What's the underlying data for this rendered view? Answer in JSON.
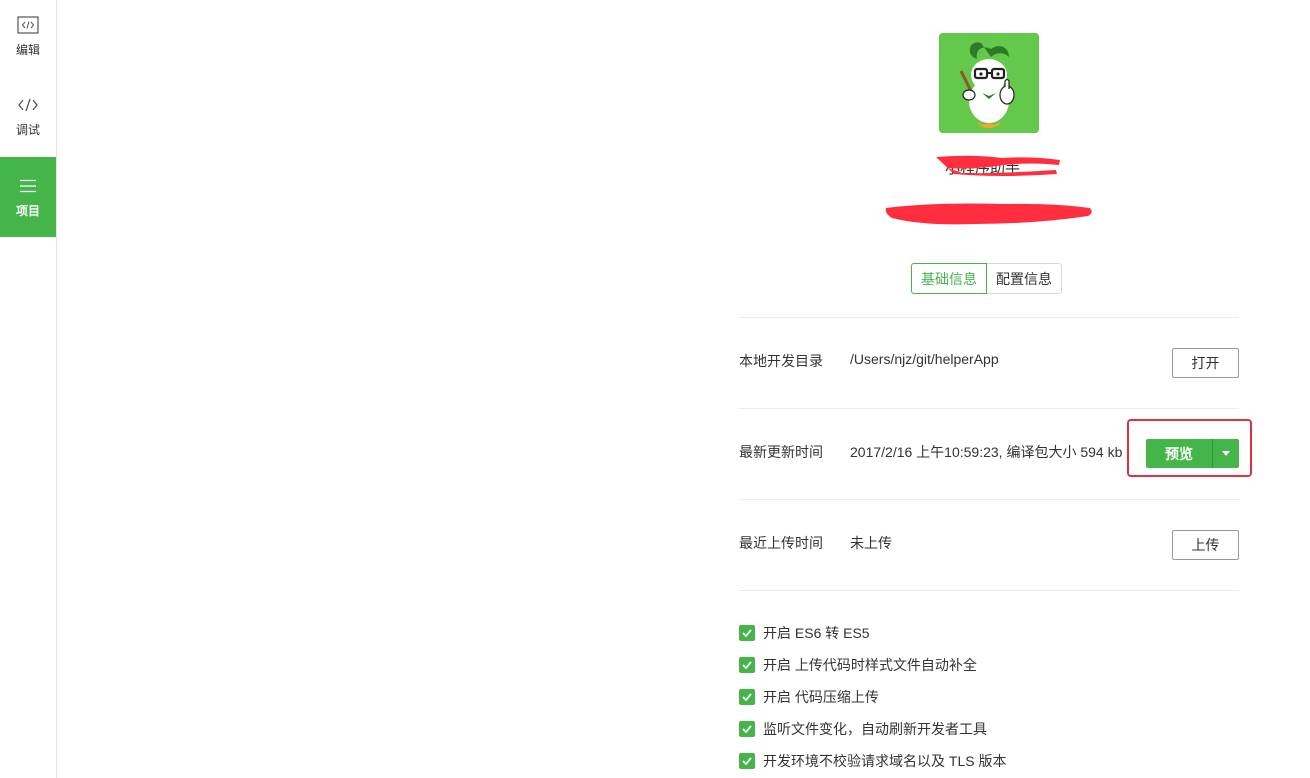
{
  "sidebar": {
    "items": [
      {
        "label": "编辑",
        "icon": "code-file-icon"
      },
      {
        "label": "调试",
        "icon": "code-brackets-icon"
      },
      {
        "label": "项目",
        "icon": "menu-lines-icon"
      }
    ]
  },
  "project": {
    "name_redacted": "小程序助手"
  },
  "tabs": [
    {
      "label": "基础信息"
    },
    {
      "label": "配置信息"
    }
  ],
  "rows": {
    "local_dir": {
      "label": "本地开发目录",
      "value": "/Users/njz/git/helperApp",
      "button": "打开"
    },
    "last_update": {
      "label": "最新更新时间",
      "value": "2017/2/16 上午10:59:23, 编译包大小 594 kb",
      "button": "预览"
    },
    "last_upload": {
      "label": "最近上传时间",
      "value": "未上传",
      "button": "上传"
    }
  },
  "options": [
    {
      "label": "开启 ES6 转 ES5",
      "checked": true
    },
    {
      "label": "开启 上传代码时样式文件自动补全",
      "checked": true
    },
    {
      "label": "开启 代码压缩上传",
      "checked": true
    },
    {
      "label": "监听文件变化，自动刷新开发者工具",
      "checked": true
    },
    {
      "label": "开发环境不校验请求域名以及 TLS 版本",
      "checked": true
    }
  ],
  "colors": {
    "accent": "#44b549",
    "highlight": "#e0313f",
    "redaction": "#ff2d3d"
  }
}
